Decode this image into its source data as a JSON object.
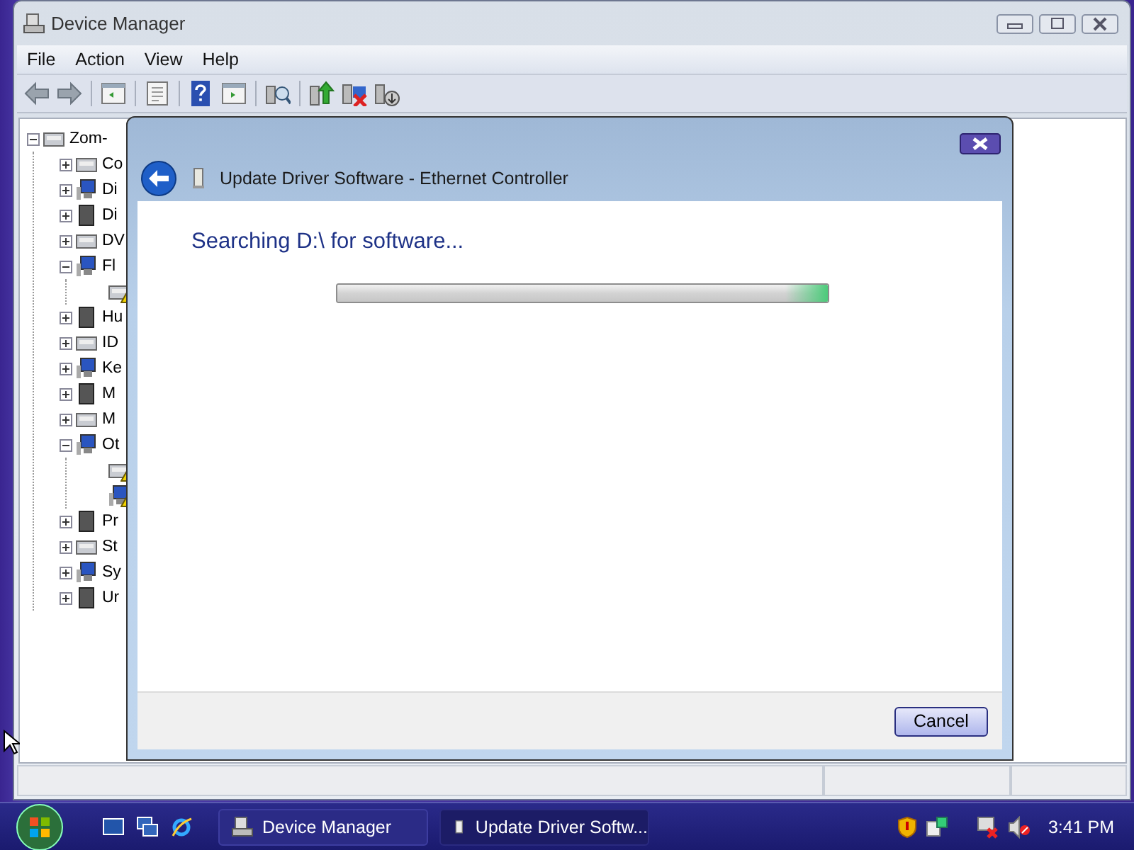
{
  "window": {
    "title": "Device Manager"
  },
  "menu": [
    "File",
    "Action",
    "View",
    "Help"
  ],
  "tree": {
    "label": "Zom-",
    "expanded": true,
    "children": [
      {
        "label": "Co",
        "expanded": false,
        "warning": false
      },
      {
        "label": "Di",
        "expanded": false,
        "warning": false
      },
      {
        "label": "Di",
        "expanded": false,
        "warning": false
      },
      {
        "label": "DV",
        "expanded": false,
        "warning": false
      },
      {
        "label": "Fl",
        "expanded": true,
        "warning": false,
        "children": [
          {
            "warning": true
          }
        ]
      },
      {
        "label": "Hu",
        "expanded": false,
        "warning": false
      },
      {
        "label": "ID",
        "expanded": false,
        "warning": false
      },
      {
        "label": "Ke",
        "expanded": false,
        "warning": false
      },
      {
        "label": "M",
        "expanded": false,
        "warning": false
      },
      {
        "label": "M",
        "expanded": false,
        "warning": false
      },
      {
        "label": "Ot",
        "expanded": true,
        "warning": false,
        "children": [
          {
            "warning": true
          },
          {
            "warning": true
          }
        ]
      },
      {
        "label": "Pr",
        "expanded": false,
        "warning": false
      },
      {
        "label": "St",
        "expanded": false,
        "warning": false
      },
      {
        "label": "Sy",
        "expanded": false,
        "warning": false
      },
      {
        "label": "Ur",
        "expanded": false,
        "warning": false
      }
    ]
  },
  "dialog": {
    "title": "Update Driver Software - Ethernet Controller",
    "heading": "Searching D:\\ for software...",
    "progress": {
      "level": 1
    },
    "buttons": [
      "Cancel"
    ]
  },
  "taskbar": {
    "tasks": [
      {
        "label": "Device Manager",
        "selected": false
      },
      {
        "label": "Update Driver Softw...",
        "selected": true
      }
    ],
    "clock": "3:41 PM"
  }
}
